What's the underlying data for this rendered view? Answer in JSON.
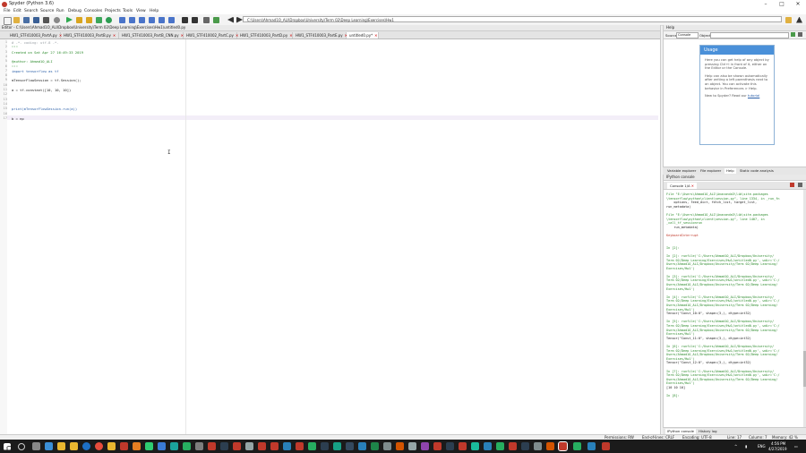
{
  "window": {
    "title": "Spyder (Python 3.6)",
    "min": "–",
    "max": "□",
    "close": "✕"
  },
  "menu": [
    "File",
    "Edit",
    "Search",
    "Source",
    "Run",
    "Debug",
    "Consoles",
    "Projects",
    "Tools",
    "View",
    "Help"
  ],
  "toolbar": {
    "path": "C:\\Users\\Ahmad1O_ALI\\Dropbox\\University\\Term 02\\Deep Learning\\Exercises\\Hw1"
  },
  "editor": {
    "header": "Editor - C:\\Users\\Ahmad1O_ALI\\Dropbox\\University\\Term 02\\Deep Learning\\Exercises\\Hw1\\untitled0.py",
    "tabs": [
      "HW1_STF410003_PartA.py",
      "HW1_STF410003_PartB.py",
      "HW1_STF410003_PartB_CNN.py",
      "HW1_STF410002_PartC.py",
      "HW1_STF410003_PartD.py",
      "HW1_STF410003_PartE.py",
      "untitled0.py*"
    ],
    "lines": [
      "# -*- coding: utf-8 -*-",
      "\"\"\"",
      "Created on Sat Apr 27 16:49:33 2019",
      "",
      "@author: Ahmad1O_ALI",
      "\"\"\"",
      "import tensorflow as tf",
      "",
      "mTensorFlowSession = tf.Session();",
      "",
      "a = tf.constant([10, 10, 10])",
      "",
      "",
      "",
      "print(mTensorFlowSession.run(a))",
      "",
      "b = np"
    ]
  },
  "help": {
    "title": "Help",
    "source_label": "Source",
    "source_value": "Console",
    "object_label": "Object",
    "usage_title": "Usage",
    "usage_p1": "Here you can get help of any object by pressing Ctrl+I in front of it, either on the Editor or the Console.",
    "usage_p2": "Help can also be shown automatically after writing a left parenthesis next to an object. You can activate this behavior in Preferences > Help.",
    "usage_p3": "New to Spyder? Read our",
    "usage_link": "tutorial",
    "tabs": [
      "Variable explorer",
      "File explorer",
      "Help",
      "Static code analysis"
    ]
  },
  "console": {
    "title": "IPython console",
    "tab": "Console 1/A",
    "lines": [
      "File \"E:\\Users\\Ahmad1O_ALI\\Anaconda3\\lib\\site-packages",
      "\\tensorflow\\python\\client\\session.py\", line 1334, in _run_fn",
      "    options, feed_dict, fetch_list, target_list,",
      "run_metadata)",
      "",
      "File \"E:\\Users\\Ahmad1O_ALI\\Anaconda3\\lib\\site-packages",
      "\\tensorflow\\python\\client\\session.py\", line 1407, in",
      "_call_tf_sessionrun",
      "    run_metadata)",
      "",
      "KeyboardInterrupt",
      "",
      "",
      "In [2]:",
      "",
      "In [2]: runfile('C:/Users/Ahmad1O_ALI/Dropbox/University/",
      "Term 02/Deep Learning/Exercises/Hw1/untitled0.py', wdir='C:/",
      "Users/Ahmad1O_ALI/Dropbox/University/Term 02/Deep Learning/",
      "Exercises/Hw1')",
      "",
      "In [3]: runfile('C:/Users/Ahmad1O_ALI/Dropbox/University/",
      "Term 02/Deep Learning/Exercises/Hw1/untitled0.py', wdir='C:/",
      "Users/Ahmad1O_ALI/Dropbox/University/Term 02/Deep Learning/",
      "Exercises/Hw1')",
      "",
      "In [4]: runfile('C:/Users/Ahmad1O_ALI/Dropbox/University/",
      "Term 02/Deep Learning/Exercises/Hw1/untitled0.py', wdir='C:/",
      "Users/Ahmad1O_ALI/Dropbox/University/Term 02/Deep Learning/",
      "Exercises/Hw1')",
      "Tensor(\"Const_10:0\", shape=(3,), dtype=int32)",
      "",
      "In [5]: runfile('C:/Users/Ahmad1O_ALI/Dropbox/University/",
      "Term 02/Deep Learning/Exercises/Hw1/untitled0.py', wdir='C:/",
      "Users/Ahmad1O_ALI/Dropbox/University/Term 02/Deep Learning/",
      "Exercises/Hw1')",
      "Tensor(\"Const_11:0\", shape=(3,), dtype=int32)",
      "",
      "In [6]: runfile('C:/Users/Ahmad1O_ALI/Dropbox/University/",
      "Term 02/Deep Learning/Exercises/Hw1/untitled0.py', wdir='C:/",
      "Users/Ahmad1O_ALI/Dropbox/University/Term 02/Deep Learning/",
      "Exercises/Hw1')",
      "Tensor(\"Const_12:0\", shape=(3,), dtype=int32)",
      "",
      "In [7]: runfile('C:/Users/Ahmad1O_ALI/Dropbox/University/",
      "Term 02/Deep Learning/Exercises/Hw1/untitled0.py', wdir='C:/",
      "Users/Ahmad1O_ALI/Dropbox/University/Term 02/Deep Learning/",
      "Exercises/Hw1')",
      "[10 10 10]",
      "",
      "In [8]:"
    ],
    "bottom_tabs": [
      "IPython console",
      "History log"
    ]
  },
  "status": {
    "permissions": "Permissions: RW",
    "eol": "End-of-lines: CRLF",
    "encoding": "Encoding: UTF-8",
    "line": "Line: 17",
    "column": "Column: 7",
    "memory": "Memory: 42 %"
  },
  "taskbar": {
    "lang": "ENG",
    "time": "4:56 PM",
    "date": "4/27/2019"
  }
}
